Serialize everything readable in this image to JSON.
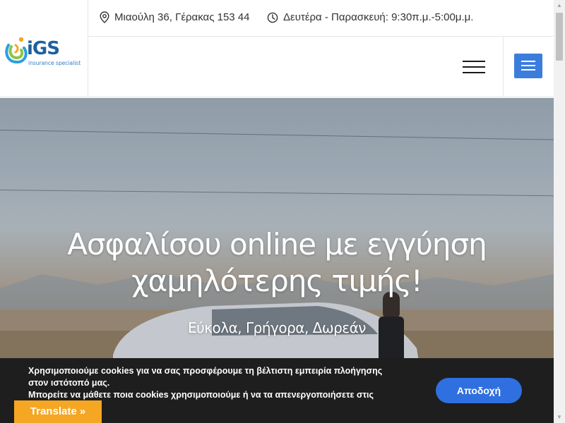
{
  "brand": {
    "logo_text": "iGS",
    "tagline": "insurance specialist",
    "colors": {
      "primary": "#1f5f9e",
      "accent_green": "#8cc63f",
      "accent_orange": "#f5a623",
      "accent_blue": "#2b9fe0"
    }
  },
  "topbar": {
    "address_icon": "map-pin-icon",
    "address": "Μιαούλη 36, Γέρακας 153 44",
    "hours_icon": "clock-icon",
    "hours": "Δευτέρα - Παρασκευή: 9:30π.μ.-5:00μ.μ."
  },
  "nav": {
    "hamburger_icon": "hamburger-icon",
    "menu_button_icon": "menu-icon",
    "menu_button_color": "#3b7ddd"
  },
  "hero": {
    "title_line1": "Ασφαλίσου online με εγγύηση",
    "title_line2": "χαμηλότερης τιμής!",
    "subtitle": "Εύκολα, Γρήγορα, Δωρεάν"
  },
  "cookie": {
    "line1": "Χρησιμοποιούμε cookies για να σας προσφέρουμε τη βέλτιστη εμπειρία πλοήγησης",
    "line2": "στον ιστότοπό μας.",
    "line3": "Μπορείτε να μάθετε ποια cookies χρησιμοποιούμε ή να τα απενεργοποιήσετε στις",
    "accept_label": "Αποδοχή",
    "accept_color": "#2f6fe0"
  },
  "translate": {
    "label": "Translate »",
    "color": "#f5a623"
  }
}
